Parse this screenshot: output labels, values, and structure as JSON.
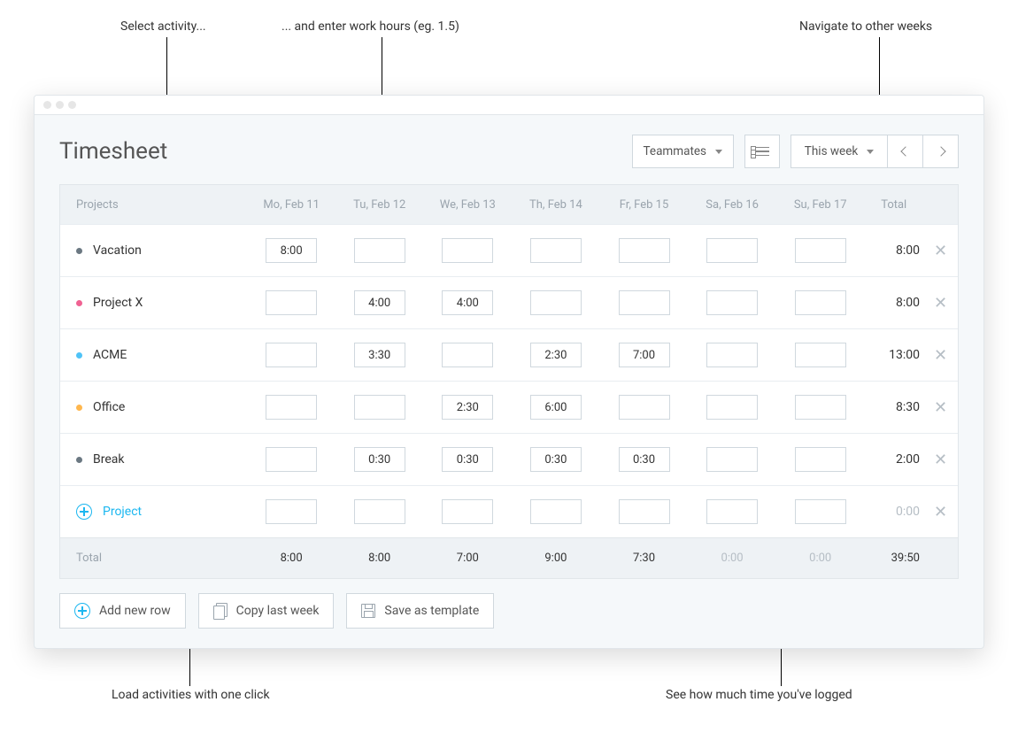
{
  "annotations": {
    "select_activity": "Select activity...",
    "enter_hours": "... and enter work hours (eg. 1.5)",
    "navigate_weeks": "Navigate to other weeks",
    "load_activities": "Load activities with one click",
    "see_logged": "See how much time you've logged"
  },
  "page": {
    "title": "Timesheet"
  },
  "controls": {
    "teammates": "Teammates",
    "period": "This week"
  },
  "table": {
    "project_header": "Projects",
    "total_header": "Total",
    "days": [
      "Mo, Feb 11",
      "Tu, Feb 12",
      "We, Feb 13",
      "Th, Feb 14",
      "Fr, Feb 15",
      "Sa, Feb 16",
      "Su, Feb 17"
    ]
  },
  "rows": [
    {
      "color": "#6b7882",
      "name": "Vacation",
      "hours": [
        "8:00",
        "",
        "",
        "",
        "",
        "",
        ""
      ],
      "total": "8:00"
    },
    {
      "color": "#f06292",
      "name": "Project X",
      "hours": [
        "",
        "4:00",
        "4:00",
        "",
        "",
        "",
        ""
      ],
      "total": "8:00"
    },
    {
      "color": "#4fc3f7",
      "name": "ACME",
      "hours": [
        "",
        "3:30",
        "",
        "2:30",
        "7:00",
        "",
        ""
      ],
      "total": "13:00"
    },
    {
      "color": "#ffb74d",
      "name": "Office",
      "hours": [
        "",
        "",
        "2:30",
        "6:00",
        "",
        "",
        ""
      ],
      "total": "8:30"
    },
    {
      "color": "#6b7882",
      "name": "Break",
      "hours": [
        "",
        "0:30",
        "0:30",
        "0:30",
        "0:30",
        "",
        ""
      ],
      "total": "2:00"
    }
  ],
  "new_row": {
    "label": "Project",
    "total": "0:00"
  },
  "totals": {
    "label": "Total",
    "days": [
      "8:00",
      "8:00",
      "7:00",
      "9:00",
      "7:30",
      "0:00",
      "0:00"
    ],
    "grand": "39:50"
  },
  "footer_buttons": {
    "add_row": "Add new row",
    "copy_week": "Copy last week",
    "save_template": "Save as template"
  }
}
